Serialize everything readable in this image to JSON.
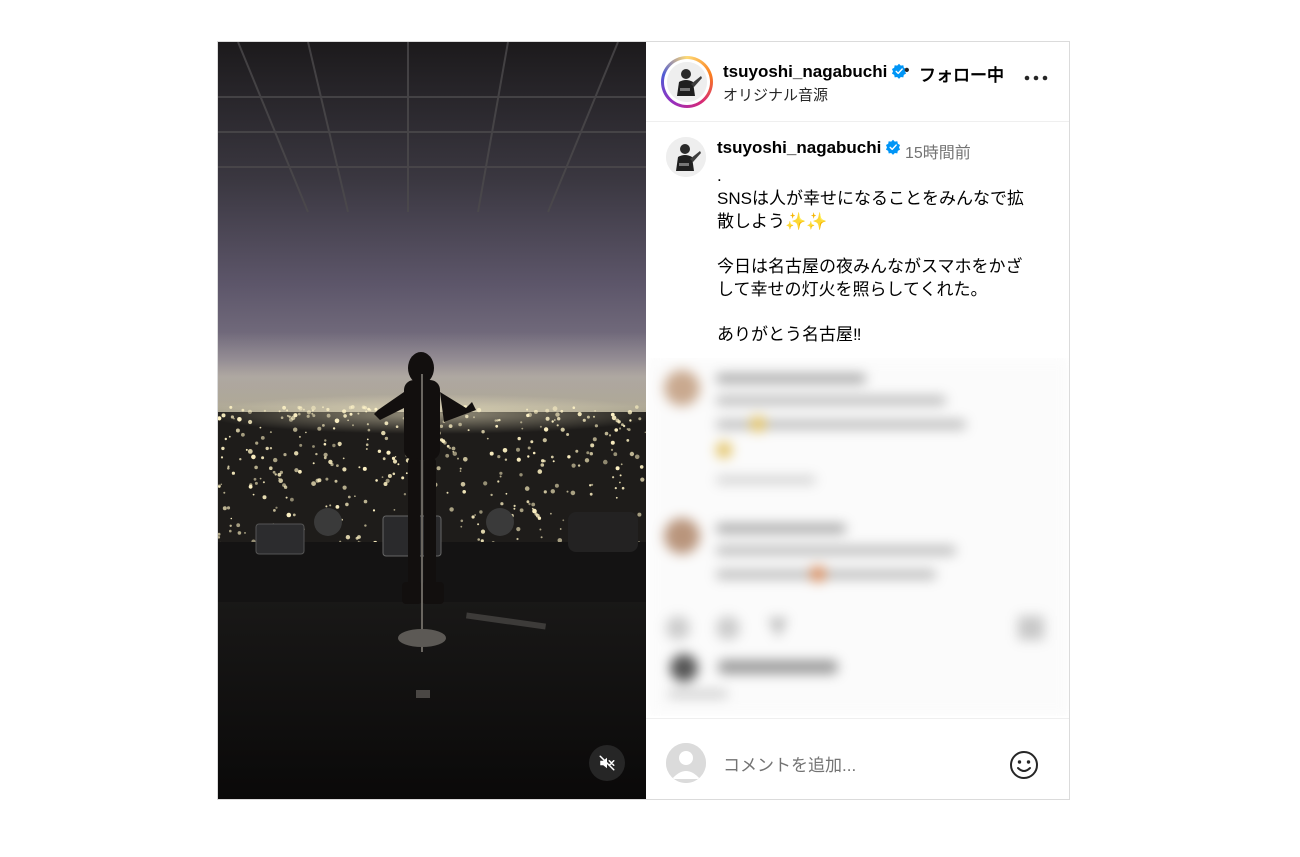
{
  "header": {
    "username": "tsuyoshi_nagabuchi",
    "separator": "•",
    "follow_label": "フォロー中",
    "audio_label": "オリジナル音源",
    "more_icon": "more-horizontal-icon"
  },
  "caption": {
    "username": "tsuyoshi_nagabuchi",
    "time": "15時間前",
    "lines": [
      ".",
      "SNSは人が幸せになることをみんなで拡",
      "散しよう✨✨",
      "",
      "今日は名古屋の夜みんながスマホをかざ",
      "して幸せの灯火を照らしてくれた。",
      "",
      "ありがとう名古屋‼"
    ]
  },
  "media": {
    "mute_icon": "speaker-muted-icon"
  },
  "footer": {
    "comment_placeholder": "コメントを追加...",
    "emoji_icon": "smiley-icon"
  },
  "colors": {
    "verified": "#0095f6",
    "secondary_text": "#737373",
    "border": "#dbdbdb"
  }
}
